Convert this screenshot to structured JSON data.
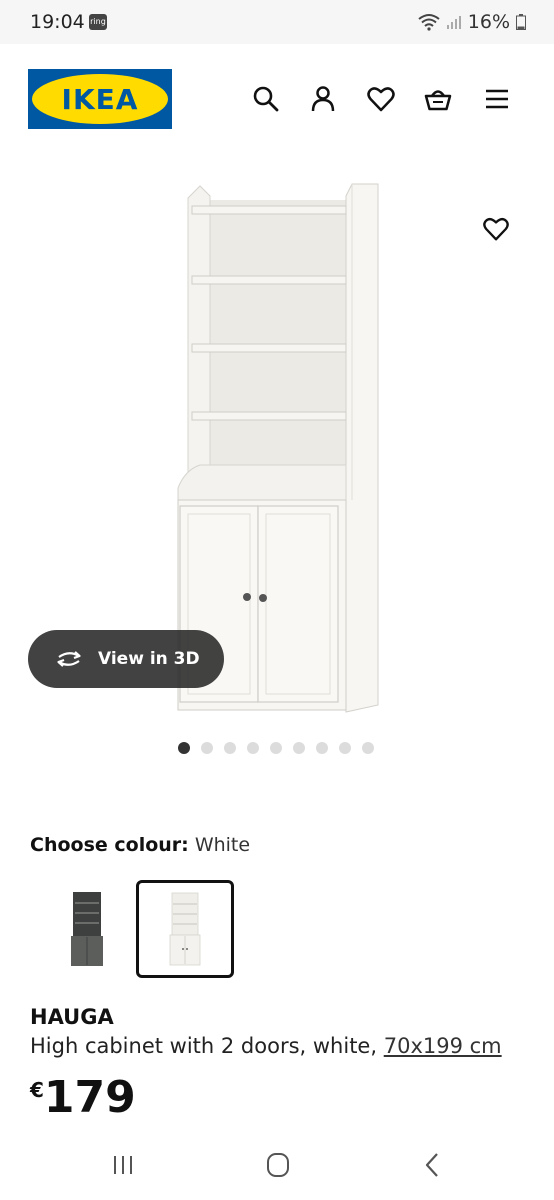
{
  "status_bar": {
    "time": "19:04",
    "app_badge": "ring",
    "battery": "16%"
  },
  "header": {
    "logo_text": "IKEA",
    "colors": {
      "logo_blue": "#0058a3",
      "logo_yellow": "#ffdb00"
    },
    "icons": [
      "search-icon",
      "account-icon",
      "heart-icon",
      "basket-icon",
      "menu-icon"
    ]
  },
  "gallery": {
    "view_3d_label": "View in 3D",
    "image_count": 9,
    "active_index": 0
  },
  "colour": {
    "label": "Choose colour:",
    "selected": "White",
    "options": [
      "grey",
      "white"
    ],
    "selected_index": 1
  },
  "product": {
    "name": "HAUGA",
    "description": "High cabinet with 2 doors, white,",
    "size_link": "70x199 cm",
    "currency": "€",
    "price": "179"
  }
}
